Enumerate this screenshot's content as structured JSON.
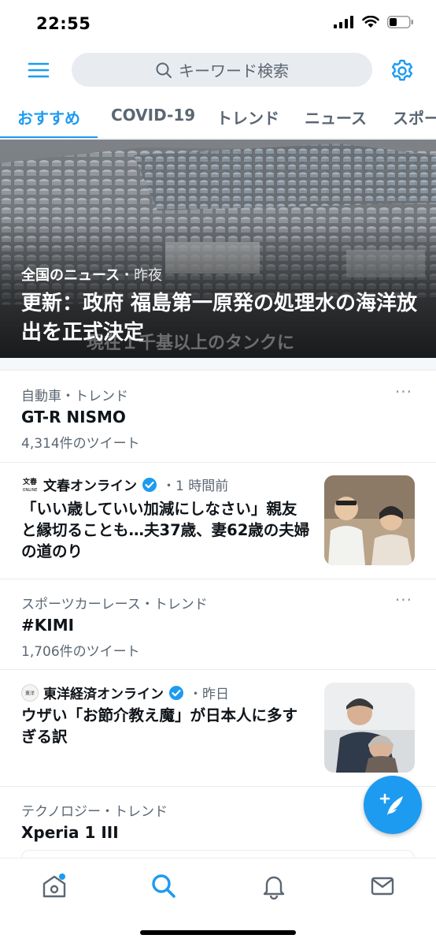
{
  "status_bar": {
    "time": "22:55"
  },
  "search": {
    "placeholder": "キーワード検索"
  },
  "tabs": [
    {
      "label": "おすすめ",
      "active": true
    },
    {
      "label": "COVID-19",
      "active": false
    },
    {
      "label": "トレンド",
      "active": false
    },
    {
      "label": "ニュース",
      "active": false
    },
    {
      "label": "スポーツ",
      "active": false
    }
  ],
  "hero": {
    "source": "全国のニュース",
    "time": "・昨夜",
    "title": "更新：政府 福島第一原発の処理水の海洋放出を正式決定",
    "caption": "現在１千基以上のタンクに"
  },
  "feed": [
    {
      "type": "trend",
      "category": "自動車・トレンド",
      "title": "GT-R NISMO",
      "count": "4,314件のツイート",
      "more": "···"
    },
    {
      "type": "news",
      "source": "文春オンライン",
      "time": "・1 時間前",
      "title": "「いい歳していい加減にしなさい」親友と縁切ることも…夫37歳、妻62歳の夫婦の道のり",
      "logo_text": "文春"
    },
    {
      "type": "trend",
      "category": "スポーツカーレース・トレンド",
      "title": "#KIMI",
      "count": "1,706件のツイート",
      "more": "···"
    },
    {
      "type": "news",
      "source": "東洋経済オンライン",
      "time": "・昨日",
      "title": "ウザい「お節介教え魔」が日本人に多すぎる訳",
      "logo_text": "東洋"
    },
    {
      "type": "trend",
      "category": "テクノロジー・トレンド",
      "title": "Xperia 1 III"
    }
  ],
  "icons": {
    "menu": "hamburger-menu-icon",
    "search": "search-icon",
    "settings": "gear-icon",
    "verified": "verified-badge-icon",
    "compose": "compose-tweet-icon",
    "nav": [
      "home-icon",
      "search-icon",
      "bell-icon",
      "mail-icon"
    ]
  },
  "colors": {
    "accent": "#1d9bf0",
    "text": "#0f1419",
    "secondary": "#5b6773"
  }
}
